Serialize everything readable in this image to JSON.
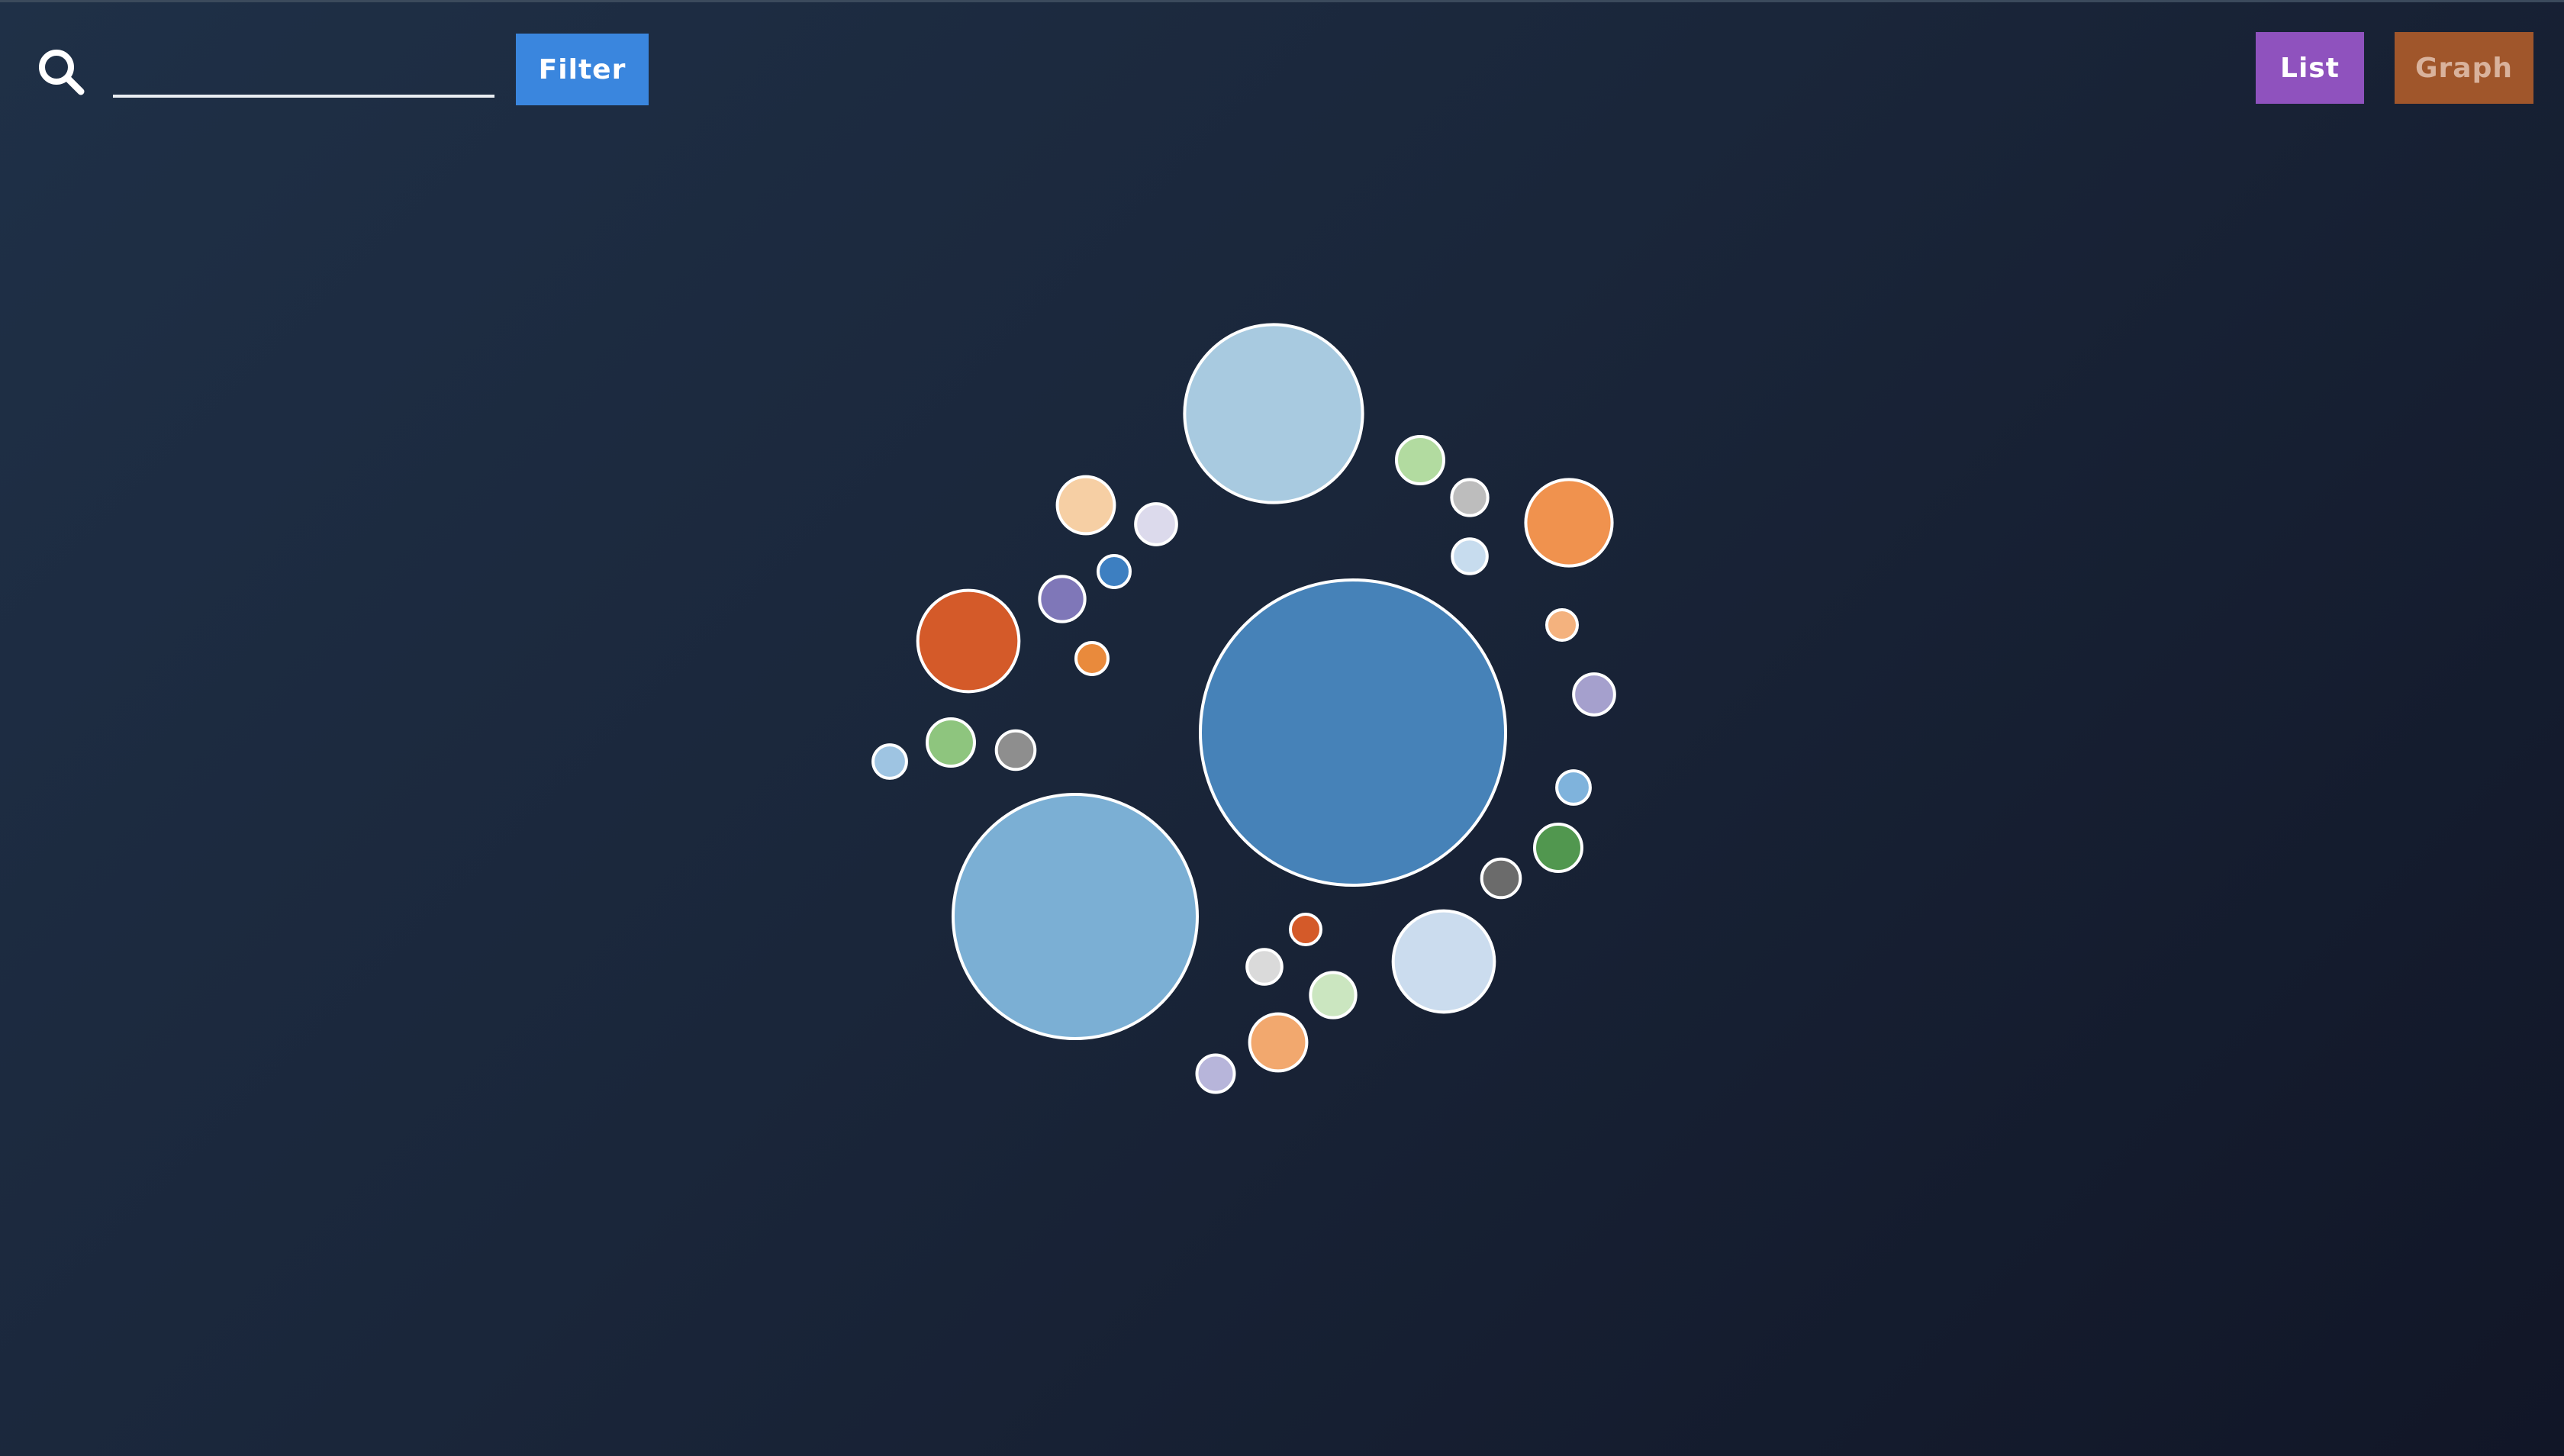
{
  "toolbar": {
    "search_value": "",
    "search_placeholder": "",
    "filter_label": "Filter"
  },
  "view_toggle": {
    "list_label": "List",
    "graph_label": "Graph"
  },
  "colors": {
    "filter_button": "#3a86de",
    "list_button": "#8f52be",
    "graph_button": "#a0562b",
    "bubble_stroke": "#ffffff"
  },
  "chart_data": {
    "type": "packed-bubble",
    "bubbles": [
      {
        "size": 100,
        "color": "#4682b8"
      },
      {
        "size": 64,
        "color": "#7bafd4"
      },
      {
        "size": 34,
        "color": "#a8cae0"
      },
      {
        "size": 11,
        "color": "#d45a29"
      },
      {
        "size": 11,
        "color": "#cbdcee"
      },
      {
        "size": 8,
        "color": "#f0924e"
      },
      {
        "size": 3.5,
        "color": "#f6cfa4"
      },
      {
        "size": 3.5,
        "color": "#f2a86e"
      },
      {
        "size": 2.4,
        "color": "#8ec57e"
      },
      {
        "size": 2.4,
        "color": "#b2dba0"
      },
      {
        "size": 2.4,
        "color": "#51974f"
      },
      {
        "size": 2.2,
        "color": "#7f77b8"
      },
      {
        "size": 2.2,
        "color": "#cbe6c0"
      },
      {
        "size": 1.8,
        "color": "#a5a0cd"
      },
      {
        "size": 1.8,
        "color": "#dcdaec"
      },
      {
        "size": 1.6,
        "color": "#8e8e8e"
      },
      {
        "size": 1.6,
        "color": "#6b6b6b"
      },
      {
        "size": 1.5,
        "color": "#b7b5da"
      },
      {
        "size": 1.4,
        "color": "#bdbdbd"
      },
      {
        "size": 1.3,
        "color": "#dadada"
      },
      {
        "size": 1.3,
        "color": "#c7dcee"
      },
      {
        "size": 1.2,
        "color": "#9ec4e2"
      },
      {
        "size": 1.2,
        "color": "#7fb3dc"
      },
      {
        "size": 1.1,
        "color": "#3d7fc1"
      },
      {
        "size": 1.1,
        "color": "#e98a3c"
      },
      {
        "size": 1.0,
        "color": "#f4b27e"
      },
      {
        "size": 1.0,
        "color": "#d45a29"
      }
    ]
  }
}
